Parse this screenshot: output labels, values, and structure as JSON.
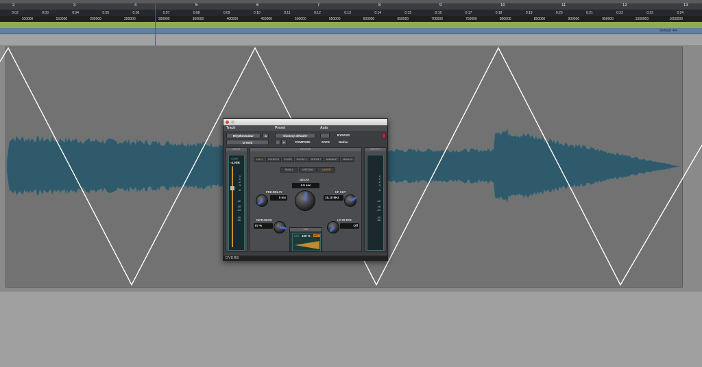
{
  "ruler": {
    "bars": [
      "2",
      "3",
      "4",
      "5",
      "6",
      "7",
      "8",
      "9",
      "10",
      "11",
      "12",
      "13"
    ],
    "min_secs": [
      "0:02",
      "0:03",
      "0:04",
      "0:05",
      "0:06",
      "0:07",
      "0:08",
      "0:09",
      "0:10",
      "0:11",
      "0:12",
      "0:13",
      "0:14",
      "0:15",
      "0:16",
      "0:17",
      "0:18",
      "0:19",
      "0:20",
      "0:21",
      "0:22",
      "0:23",
      "0:24"
    ],
    "samples": [
      "100000",
      "150000",
      "200000",
      "250000",
      "300000",
      "350000",
      "400000",
      "450000",
      "500000",
      "550000",
      "600000",
      "650000",
      "700000",
      "750000",
      "800000",
      "850000",
      "900000",
      "950000",
      "1000000",
      "1050000"
    ],
    "meter": "Default: 4/4"
  },
  "colors": {
    "tempo_ruler": "#8fac55",
    "meter_ruler": "#62809f",
    "waveform": "#2f5a6b",
    "automation": "#ffffff",
    "playhead": "#c0302a"
  },
  "plugin": {
    "header": {
      "track": "Track",
      "preset": "Preset",
      "auto": "Auto"
    },
    "track_name": "RhythmGuitar",
    "track_suffix": "a",
    "plugin_name": "D-Verb",
    "preset_name": "<factory default>",
    "compare": "COMPARE",
    "bypass": "BYPASS",
    "safe": "SAFE",
    "native": "Native",
    "stepper": [
      "-",
      "+"
    ],
    "input_label": "INPUT",
    "output_label": "OUTPUT",
    "reverb_label": "REVERB",
    "gain_label": "GAIN",
    "gain_value": "-4.0dB",
    "algorithms": [
      "HALL",
      "CHURCH",
      "PLATE",
      "ROOM 1",
      "ROOM 2",
      "AMBIENT",
      "NONLIN"
    ],
    "selected_algorithm": "HALL",
    "sizes": [
      "SMALL",
      "MEDIUM",
      "LARGE"
    ],
    "selected_size": "LARGE",
    "decay": {
      "label": "DECAY",
      "value": "4.5 sec"
    },
    "pre_delay": {
      "label": "PRE-DELAY",
      "value": "0 ms"
    },
    "hf_cut": {
      "label": "HF CUT",
      "value": "15.10 kHz"
    },
    "diffusion": {
      "label": "DIFFUSION",
      "value": "87 %"
    },
    "lp_filter": {
      "label": "LP FILTER",
      "value": "Off"
    },
    "mix": {
      "label": "MIX",
      "dry": "DRY",
      "value": "100 %",
      "wet": "WET",
      "level": 1.0
    },
    "meter_scale": [
      "0",
      "-1",
      "-2",
      "-3",
      "-6",
      "-12",
      "-18",
      "-24",
      "-40",
      "-56"
    ],
    "footer": "DVERB"
  }
}
